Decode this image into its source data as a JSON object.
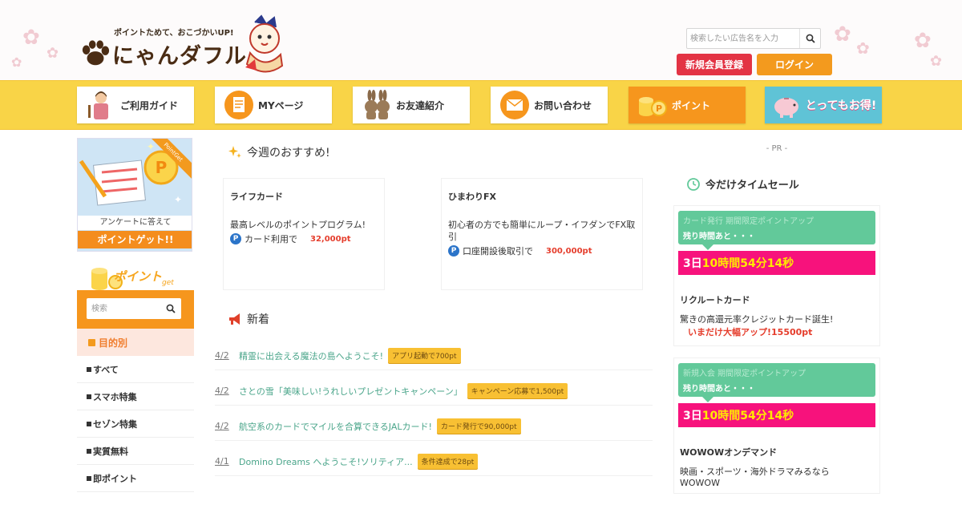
{
  "header": {
    "tagline": "ポイントためて、おこづかいUP!",
    "brand": "にゃんダフル",
    "search_placeholder": "検索したい広告名を入力",
    "register_label": "新規会員登録",
    "login_label": "ログイン"
  },
  "nav": {
    "items": [
      {
        "label": "ご利用ガイド",
        "icon": "guide-person-icon"
      },
      {
        "label": "MYページ",
        "icon": "mypage-icon"
      },
      {
        "label": "お友達紹介",
        "icon": "rabbits-icon"
      },
      {
        "label": "お問い合わせ",
        "icon": "mail-icon"
      },
      {
        "label": "ポイント",
        "icon": "coins-icon"
      },
      {
        "label": "とってもお得!",
        "icon": "piggy-bank-icon"
      }
    ]
  },
  "left": {
    "survey_caption": "アンケートに答えて",
    "survey_cta": "ポイントゲット!!",
    "survey_ribbon": "PointGet",
    "point_search_title": "ポイント",
    "point_search_sub": "get",
    "search_placeholder": "検索",
    "category_heading": "目的別",
    "categories": [
      "すべて",
      "スマホ特集",
      "セゾン特集",
      "実質無料",
      "即ポイント"
    ]
  },
  "center": {
    "recommend_title": "今週のおすすめ!",
    "recommend": [
      {
        "name": "ライフカード",
        "desc": "最高レベルのポイントプログラム!",
        "cond": "カード利用で",
        "pt": "32,000pt"
      },
      {
        "name": "ひまわりFX",
        "desc": "初心者の方でも簡単にループ・イフダンでFX取引",
        "cond": "口座開設後取引で",
        "pt": "300,000pt"
      }
    ],
    "news_title": "新着",
    "news": [
      {
        "date": "4/2",
        "title": "精霊に出会える魔法の島へようこそ!",
        "badge": "アプリ起動で700pt"
      },
      {
        "date": "4/2",
        "title": "さとの雪「美味しい!うれしいプレゼントキャンペーン」",
        "badge": "キャンペーン応募で1,500pt"
      },
      {
        "date": "4/2",
        "title": "航空系のカードでマイルを合算できるJALカード!",
        "badge": "カード発行で90,000pt"
      },
      {
        "date": "4/1",
        "title": "Domino Dreams へようこそ!ソリティア...",
        "badge": "条件達成で28pt"
      }
    ]
  },
  "right": {
    "pr_label": "- PR -",
    "timesale_title": "今だけタイムセール",
    "sales": [
      {
        "faded": "カード発行 期間限定ポイントアップ",
        "remain_label": "残り時間あと・・・",
        "days": "3日",
        "time": "10時間54分14秒",
        "name": "リクルートカード",
        "desc": "驚きの高還元率クレジットカード誕生!",
        "highlight": "いまだけ大幅アップ!15500pt"
      },
      {
        "faded": "新規入会 期間限定ポイントアップ",
        "remain_label": "残り時間あと・・・",
        "days": "3日",
        "time": "10時間54分14秒",
        "name": "WOWOWオンデマンド",
        "desc": "映画・スポーツ・海外ドラマみるなら",
        "desc2": "WOWOW"
      }
    ]
  },
  "colors": {
    "nav_band": "#f9d447",
    "accent_orange": "#f6961d",
    "register_red": "#e33344",
    "timesale_green": "#62c99a",
    "timesale_pink": "#f7127c",
    "news_link": "#4aa58a",
    "point_red": "#e53d2c"
  }
}
